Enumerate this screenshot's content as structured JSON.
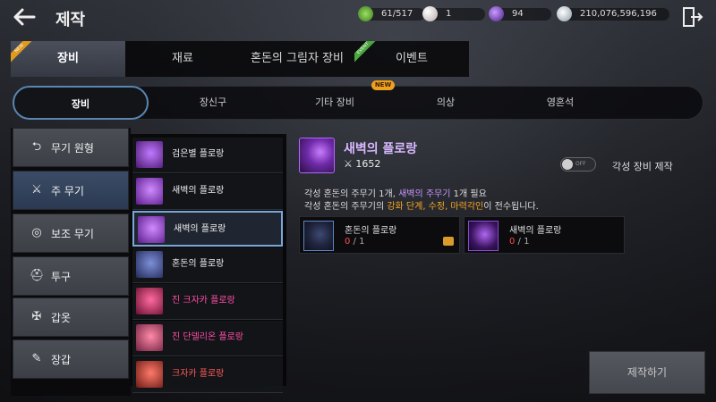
{
  "header": {
    "title": "제작",
    "currencies": [
      {
        "icon": "green-gem-icon",
        "value": "61/517",
        "color": "#5fae3c"
      },
      {
        "icon": "pearl-icon",
        "value": "1",
        "color": "#e8dede"
      },
      {
        "icon": "purple-orb-icon",
        "value": "94",
        "color": "#7a3cc8"
      },
      {
        "icon": "silver-coin-icon",
        "value": "210,076,596,196",
        "color": "#cfd6dd"
      }
    ]
  },
  "main_tabs": [
    {
      "label": "장비",
      "active": true,
      "badge": "NEW"
    },
    {
      "label": "재료",
      "active": false
    },
    {
      "label": "혼돈의 그림자 장비",
      "active": false
    },
    {
      "label": "이벤트",
      "active": false,
      "badge": "EVENT"
    }
  ],
  "sub_tabs": [
    {
      "label": "장비",
      "active": true
    },
    {
      "label": "장신구"
    },
    {
      "label": "기타 장비",
      "badge": "NEW"
    },
    {
      "label": "의상"
    },
    {
      "label": "영혼석"
    }
  ],
  "categories": [
    {
      "label": "무기 원형",
      "icon": "return-arrow-icon"
    },
    {
      "label": "주 무기",
      "icon": "crossed-swords-icon",
      "active": true
    },
    {
      "label": "보조 무기",
      "icon": "ring-icon"
    },
    {
      "label": "투구",
      "icon": "helmet-icon"
    },
    {
      "label": "갑옷",
      "icon": "armor-icon"
    },
    {
      "label": "장갑",
      "icon": "glove-icon"
    }
  ],
  "items": [
    {
      "label": "검은별 플로랑",
      "color": "#f0f0f0",
      "thumb": "#8a3fc8"
    },
    {
      "label": "새벽의 플로랑",
      "color": "#f0f0f0",
      "thumb": "#9a48d8"
    },
    {
      "label": "새벽의 플로랑",
      "color": "#f0f0f0",
      "thumb": "#9a48d8",
      "selected": true
    },
    {
      "label": "혼돈의 플로랑",
      "color": "#f0f0f0",
      "thumb": "#4f63a8"
    },
    {
      "label": "진 크자카 플로랑",
      "color": "#ff4fa8",
      "thumb": "#c8306a"
    },
    {
      "label": "진 단델리온 플로랑",
      "color": "#ff4fa8",
      "thumb": "#d05080"
    },
    {
      "label": "크자카 플로랑",
      "color": "#ff5a5a",
      "thumb": "#c83a3a"
    }
  ],
  "detail": {
    "name": "새벽의 플로랑",
    "power_icon": "crossed-swords-icon",
    "power": "1652",
    "toggle_text": "OFF",
    "toggle_label": "각성 장비 제작",
    "line1": {
      "a": "각성 혼돈의 주무기 1개, ",
      "b": "새벽의 주무기",
      "c": " 1개 필요"
    },
    "line2": {
      "a": "각성 혼돈의 주무기의 ",
      "b": "강화 단계, 수정, 마력각인",
      "c": "이 전수됩니다."
    },
    "materials": [
      {
        "name": "혼돈의 플로랑",
        "have": "0",
        "need": "1"
      },
      {
        "name": "새벽의 플로랑",
        "have": "0",
        "need": "1"
      }
    ]
  },
  "craft_button": "제작하기"
}
